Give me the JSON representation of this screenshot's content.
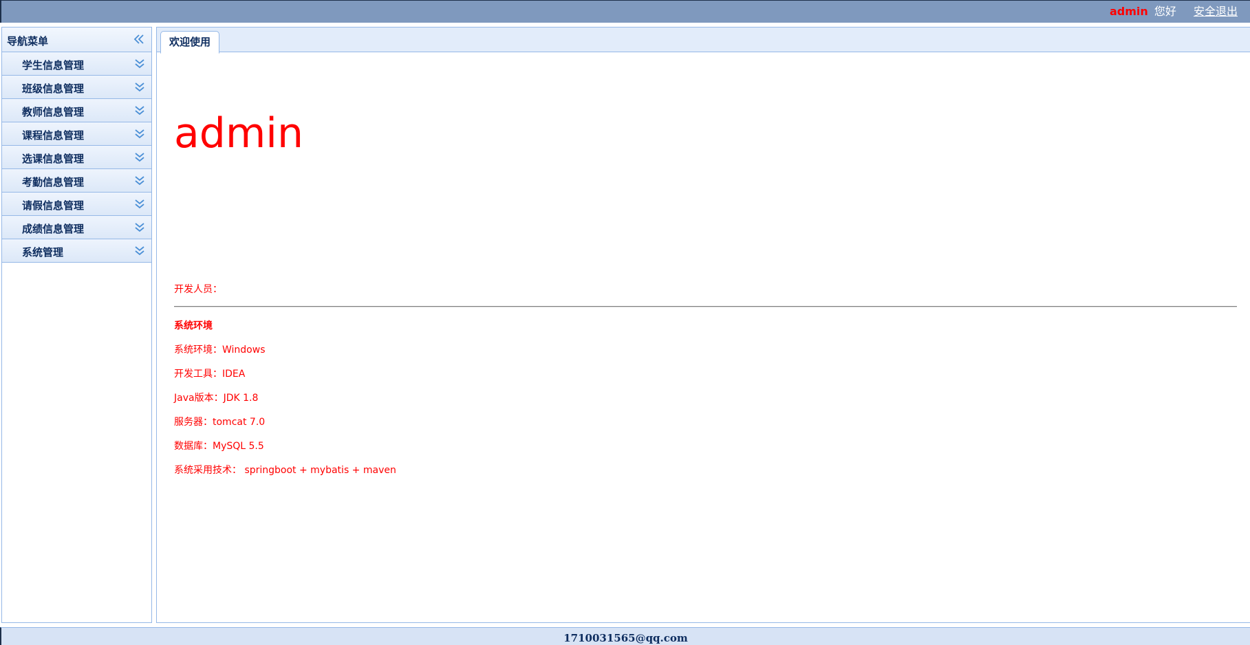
{
  "header": {
    "user_name": "admin",
    "greeting": "您好",
    "logout_label": "安全退出"
  },
  "sidebar": {
    "title": "导航菜单",
    "collapse_icon": "double-chevron-left-icon",
    "items": [
      {
        "label": "学生信息管理",
        "icon": "double-chevron-down-icon"
      },
      {
        "label": "班级信息管理",
        "icon": "double-chevron-down-icon"
      },
      {
        "label": "教师信息管理",
        "icon": "double-chevron-down-icon"
      },
      {
        "label": "课程信息管理",
        "icon": "double-chevron-down-icon"
      },
      {
        "label": "选课信息管理",
        "icon": "double-chevron-down-icon"
      },
      {
        "label": "考勤信息管理",
        "icon": "double-chevron-down-icon"
      },
      {
        "label": "请假信息管理",
        "icon": "double-chevron-down-icon"
      },
      {
        "label": "成绩信息管理",
        "icon": "double-chevron-down-icon"
      },
      {
        "label": "系统管理",
        "icon": "double-chevron-down-icon"
      }
    ]
  },
  "tabs": [
    {
      "label": "欢迎使用",
      "active": true
    }
  ],
  "welcome": {
    "user_name": "admin",
    "developer_label": "开发人员：",
    "env_title": "系统环境",
    "env_lines": [
      "系统环境：Windows",
      "开发工具：IDEA",
      "Java版本：JDK 1.8",
      "服务器：tomcat 7.0",
      "数据库：MySQL 5.5",
      "系统采用技术： springboot + mybatis + maven"
    ]
  },
  "footer": {
    "email": "1710031565@qq.com"
  },
  "colors": {
    "header_bg": "#7f99be",
    "accent_red": "#ff0000",
    "panel_border": "#95b8e7",
    "menu_text": "#0e2d5f",
    "icon_blue": "#4a8fd6"
  }
}
